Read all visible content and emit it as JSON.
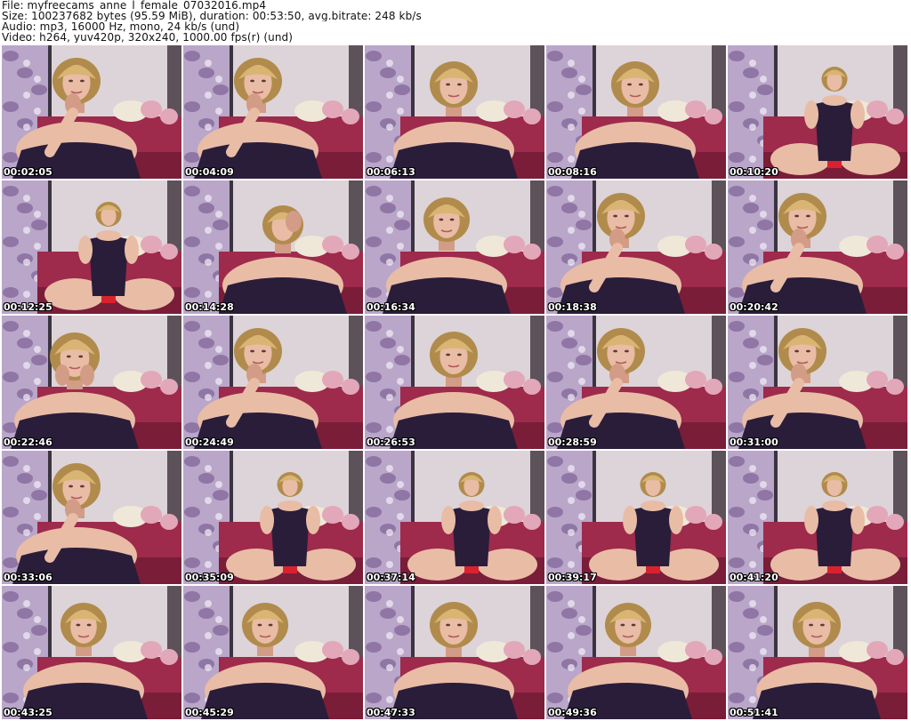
{
  "header": {
    "file_line": "File: myfreecams_anne_l_female_07032016.mp4",
    "size_line": "Size: 100237682 bytes (95.59 MiB), duration: 00:53:50, avg.bitrate: 248 kb/s",
    "audio_line": "Audio: mp3, 16000 Hz, mono, 24 kb/s (und)",
    "video_line": "Video: h264, yuv420p, 320x240, 1000.00 fps(r) (und)"
  },
  "thumbnails": [
    {
      "timestamp": "00:02:05",
      "pose": "hand-chin"
    },
    {
      "timestamp": "00:04:09",
      "pose": "hand-chin"
    },
    {
      "timestamp": "00:06:13",
      "pose": "lean"
    },
    {
      "timestamp": "00:08:16",
      "pose": "lean"
    },
    {
      "timestamp": "00:10:20",
      "pose": "seated-far"
    },
    {
      "timestamp": "00:12:25",
      "pose": "seated-far"
    },
    {
      "timestamp": "00:14:28",
      "pose": "head-down"
    },
    {
      "timestamp": "00:16:34",
      "pose": "upright"
    },
    {
      "timestamp": "00:18:38",
      "pose": "hand-chin"
    },
    {
      "timestamp": "00:20:42",
      "pose": "hand-chin"
    },
    {
      "timestamp": "00:22:46",
      "pose": "hands-face"
    },
    {
      "timestamp": "00:24:49",
      "pose": "hand-chin"
    },
    {
      "timestamp": "00:26:53",
      "pose": "lean"
    },
    {
      "timestamp": "00:28:59",
      "pose": "hand-chin"
    },
    {
      "timestamp": "00:31:00",
      "pose": "hand-chin"
    },
    {
      "timestamp": "00:33:06",
      "pose": "hand-chin"
    },
    {
      "timestamp": "00:35:09",
      "pose": "seated-far"
    },
    {
      "timestamp": "00:37:14",
      "pose": "seated-far"
    },
    {
      "timestamp": "00:39:17",
      "pose": "seated-far"
    },
    {
      "timestamp": "00:41:20",
      "pose": "seated-far"
    },
    {
      "timestamp": "00:43:25",
      "pose": "upright"
    },
    {
      "timestamp": "00:45:29",
      "pose": "upright"
    },
    {
      "timestamp": "00:47:33",
      "pose": "lean"
    },
    {
      "timestamp": "00:49:36",
      "pose": "upright"
    },
    {
      "timestamp": "00:51:41",
      "pose": "lean"
    }
  ],
  "colors": {
    "wall": "#dcd4d8",
    "poster": "#b9a6c9",
    "poster_dark": "#6d4f86",
    "couch": "#9e2a4c",
    "couch_dark": "#7a1d39",
    "top": "#2a1d3a",
    "skin": "#e9bca6",
    "skin_shadow": "#d39c86",
    "hair": "#d8b572",
    "hair_dark": "#b18b4c",
    "plush": "#efe8d8",
    "plush_pink": "#e2a7b8",
    "red": "#d8232f"
  }
}
